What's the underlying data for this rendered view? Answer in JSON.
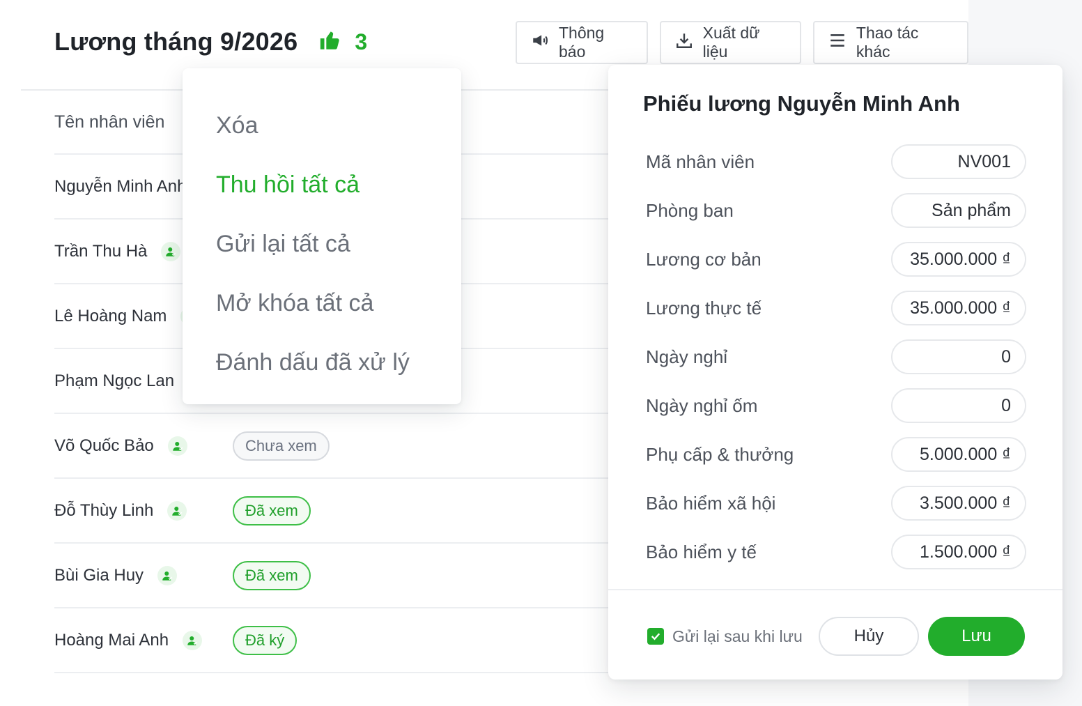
{
  "header": {
    "title": "Lương tháng 9/2026",
    "like_icon": "thumbs-up-icon",
    "like_count": "3"
  },
  "toolbar": {
    "notify_label": "Thông báo",
    "notify_icon": "megaphone-icon",
    "export_label": "Xuất dữ liệu",
    "export_icon": "download-icon",
    "more_label": "Thao tác khác",
    "more_icon": "menu-icon"
  },
  "table": {
    "column_name": "Tên nhân viên",
    "rows": [
      {
        "name": "Nguyễn Minh Anh",
        "status": ""
      },
      {
        "name": "Trần Thu Hà",
        "status": ""
      },
      {
        "name": "Lê Hoàng Nam",
        "status": ""
      },
      {
        "name": "Phạm Ngọc Lan",
        "status": ""
      },
      {
        "name": "Võ Quốc Bảo",
        "status": "Chưa xem"
      },
      {
        "name": "Đỗ Thùy Linh",
        "status": "Đã xem"
      },
      {
        "name": "Bùi Gia Huy",
        "status": "Đã xem"
      },
      {
        "name": "Hoàng Mai Anh",
        "status": "Đã ký"
      }
    ]
  },
  "dropdown": {
    "items": [
      {
        "label": "Xóa"
      },
      {
        "label": "Thu hồi tất cả"
      },
      {
        "label": "Gửi lại tất cả"
      },
      {
        "label": "Mở khóa tất cả"
      },
      {
        "label": "Đánh dấu đã xử lý"
      }
    ]
  },
  "payslip": {
    "title": "Phiếu lương Nguyễn Minh Anh",
    "fields": [
      {
        "label": "Mã nhân viên",
        "value": "NV001"
      },
      {
        "label": "Phòng ban",
        "value": "Sản phẩm"
      },
      {
        "label": "Lương cơ bản",
        "value": "35.000.000 ₫"
      },
      {
        "label": "Lương thực tế",
        "value": "35.000.000 ₫"
      },
      {
        "label": "Ngày nghỉ",
        "value": "0"
      },
      {
        "label": "Ngày nghỉ ốm",
        "value": "0"
      },
      {
        "label": "Phụ cấp & thưởng",
        "value": "5.000.000 ₫"
      },
      {
        "label": "Bảo hiểm xã hội",
        "value": "3.500.000 ₫"
      },
      {
        "label": "Bảo hiểm y tế",
        "value": "1.500.000 ₫"
      }
    ],
    "resend_label": "Gửi lại sau khi lưu",
    "resend_checked": true,
    "cancel_label": "Hủy",
    "save_label": "Lưu"
  },
  "colors": {
    "accent": "#22ad2c",
    "badge_gray": "#6b7280",
    "badge_green": "#1f9f2a"
  }
}
